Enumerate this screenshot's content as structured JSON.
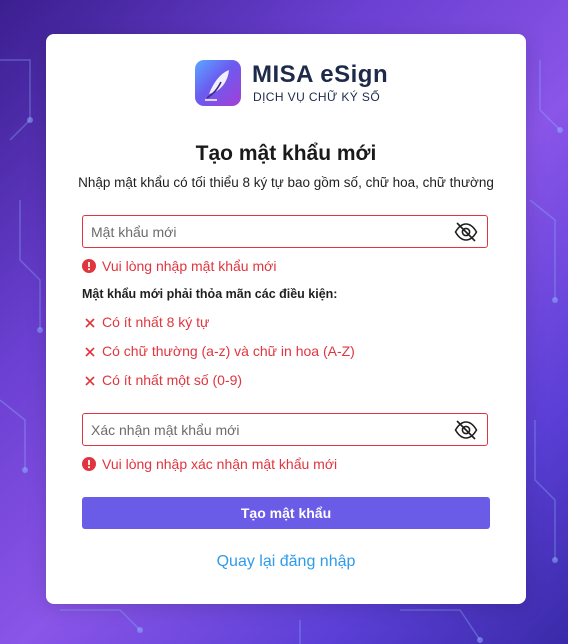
{
  "brand": {
    "name": "MISA eSign",
    "tagline": "DỊCH VỤ CHỮ KÝ SỐ"
  },
  "form": {
    "title": "Tạo mật khẩu mới",
    "subtitle": "Nhập mật khẩu có tối thiểu 8 ký tự bao gồm số, chữ hoa, chữ thường",
    "new_password": {
      "placeholder": "Mật khẩu mới",
      "value": "",
      "error": "Vui lòng nhập mật khẩu mới"
    },
    "conditions_title": "Mật khẩu mới phải thỏa mãn các điều kiện:",
    "conditions": [
      "Có ít nhất 8 ký tự",
      "Có chữ thường (a-z) và chữ in hoa (A-Z)",
      "Có ít nhất một số (0-9)"
    ],
    "confirm_password": {
      "placeholder": "Xác nhận mật khẩu mới",
      "value": "",
      "error": "Vui lòng nhập xác nhận mật khẩu mới"
    },
    "submit_label": "Tạo mật khẩu",
    "back_link": "Quay lại đăng nhập"
  },
  "colors": {
    "accent": "#6b5ce7",
    "error": "#e0353f",
    "link": "#2f9bea",
    "background": "#6a3fd1"
  },
  "icons": [
    "eye-off-icon",
    "error-circle-icon",
    "close-x-icon",
    "logo-feather-icon"
  ]
}
